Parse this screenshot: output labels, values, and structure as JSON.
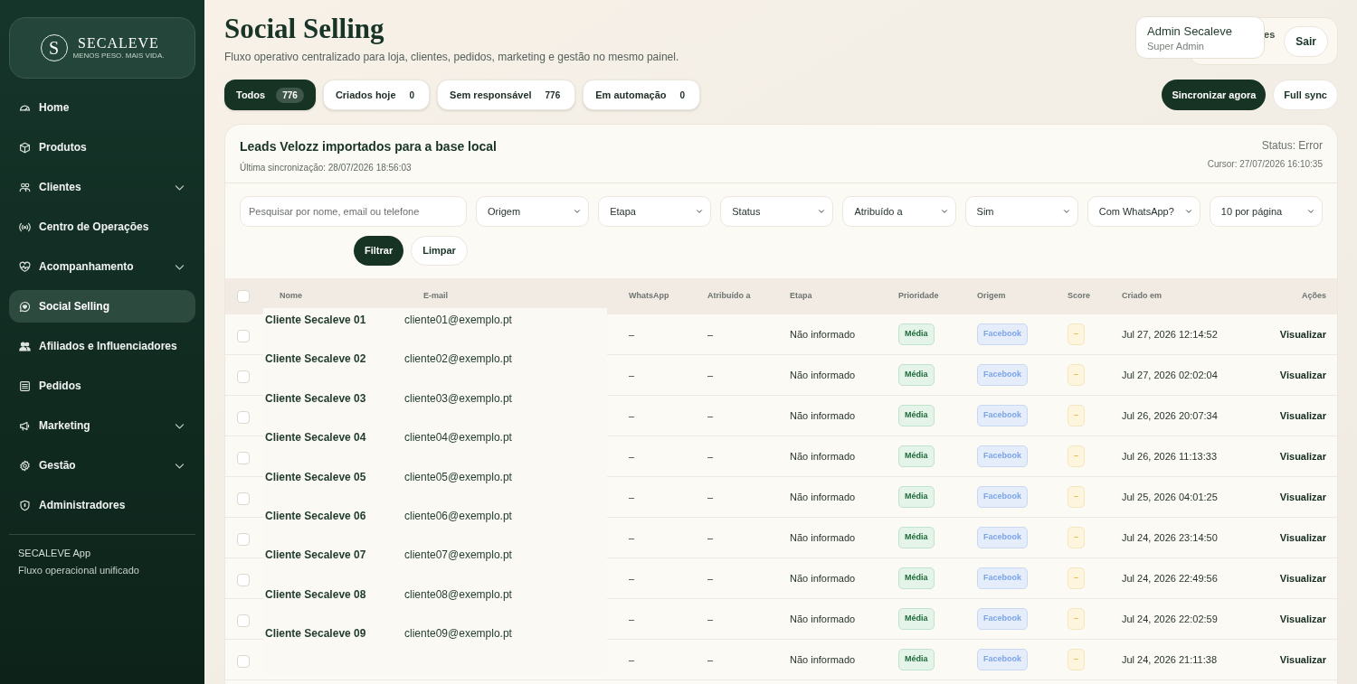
{
  "sidebar": {
    "logo": {
      "mark": "S",
      "name": "SECALEVE",
      "tagline": "MENOS PESO. MAIS VIDA."
    },
    "items": [
      {
        "label": "Home",
        "has_submenu": false,
        "selected": false
      },
      {
        "label": "Produtos",
        "has_submenu": false,
        "selected": false
      },
      {
        "label": "Clientes",
        "has_submenu": true,
        "selected": false
      },
      {
        "label": "Centro de Operações",
        "has_submenu": false,
        "selected": false
      },
      {
        "label": "Acompanhamento",
        "has_submenu": true,
        "selected": false
      },
      {
        "label": "Social Selling",
        "has_submenu": false,
        "selected": true
      },
      {
        "label": "Afiliados e Influenciadores",
        "has_submenu": false,
        "selected": false
      },
      {
        "label": "Pedidos",
        "has_submenu": false,
        "selected": false
      },
      {
        "label": "Marketing",
        "has_submenu": true,
        "selected": false
      },
      {
        "label": "Gestão",
        "has_submenu": true,
        "selected": false
      },
      {
        "label": "Administradores",
        "has_submenu": false,
        "selected": false
      }
    ],
    "footer": {
      "title": "SECALEVE App",
      "subtitle": "Fluxo operacional unificado"
    }
  },
  "header": {
    "title": "Social Selling",
    "subtitle": "Fluxo operativo centralizado para loja, clientes, pedidos, marketing e gestão no mesmo painel.",
    "user": {
      "name": "Admin Secaleve",
      "role": "Super Admin",
      "hidden_label": "es",
      "logout": "Sair"
    }
  },
  "tabs": [
    {
      "label": "Todos",
      "count": "776",
      "selected": true
    },
    {
      "label": "Criados hoje",
      "count": "0",
      "selected": false
    },
    {
      "label": "Sem responsável",
      "count": "776",
      "selected": false
    },
    {
      "label": "Em automação",
      "count": "0",
      "selected": false
    }
  ],
  "actions": [
    {
      "label": "Sincronizar agora",
      "kind": "primary"
    },
    {
      "label": "Full sync",
      "kind": "secondary"
    }
  ],
  "panel": {
    "title": "Leads Velozz importados para a base local",
    "last_sync": "Última sincronização: 28/07/2026 18:56:03",
    "status": "Status: Error",
    "cursor": "Cursor: 27/07/2026 16:10:35",
    "search": {
      "placeholder": "Pesquisar por nome, email ou telefone"
    },
    "filters": [
      "Origem",
      "Etapa",
      "Status",
      "Atribuído a",
      "Sim",
      "Com WhatsApp?",
      "10 por página"
    ],
    "buttons": [
      {
        "label": "Filtrar",
        "kind": "primary"
      },
      {
        "label": "Limpar",
        "kind": "secondary"
      }
    ]
  },
  "table": {
    "select_all": {
      "checked": false
    },
    "columns": [
      "Nome",
      "E-mail",
      "WhatsApp",
      "Atribuído a",
      "Etapa",
      "Prioridade",
      "Origem",
      "Score",
      "Criado em",
      "Ações"
    ],
    "rows": [
      {
        "checked": false,
        "name": "Cliente Secaleve 01",
        "email": "cliente01@exemplo.pt",
        "whatsapp": "–",
        "assigned": "–",
        "stage": "Não informado",
        "priority": "Média",
        "origin": "Facebook",
        "score": "–",
        "created": "Jul 27, 2026 12:14:52",
        "action": "Visualizar"
      },
      {
        "checked": false,
        "name": "Cliente Secaleve 02",
        "email": "cliente02@exemplo.pt",
        "whatsapp": "–",
        "assigned": "–",
        "stage": "Não informado",
        "priority": "Média",
        "origin": "Facebook",
        "score": "–",
        "created": "Jul 27, 2026 02:02:04",
        "action": "Visualizar"
      },
      {
        "checked": false,
        "name": "Cliente Secaleve 03",
        "email": "cliente03@exemplo.pt",
        "whatsapp": "–",
        "assigned": "–",
        "stage": "Não informado",
        "priority": "Média",
        "origin": "Facebook",
        "score": "–",
        "created": "Jul 26, 2026 20:07:34",
        "action": "Visualizar"
      },
      {
        "checked": false,
        "name": "Cliente Secaleve 04",
        "email": "cliente04@exemplo.pt",
        "whatsapp": "–",
        "assigned": "–",
        "stage": "Não informado",
        "priority": "Média",
        "origin": "Facebook",
        "score": "–",
        "created": "Jul 26, 2026 11:13:33",
        "action": "Visualizar"
      },
      {
        "checked": false,
        "name": "Cliente Secaleve 05",
        "email": "cliente05@exemplo.pt",
        "whatsapp": "–",
        "assigned": "–",
        "stage": "Não informado",
        "priority": "Média",
        "origin": "Facebook",
        "score": "–",
        "created": "Jul 25, 2026 04:01:25",
        "action": "Visualizar"
      },
      {
        "checked": false,
        "name": "Cliente Secaleve 06",
        "email": "cliente06@exemplo.pt",
        "whatsapp": "–",
        "assigned": "–",
        "stage": "Não informado",
        "priority": "Média",
        "origin": "Facebook",
        "score": "–",
        "created": "Jul 24, 2026 23:14:50",
        "action": "Visualizar"
      },
      {
        "checked": false,
        "name": "Cliente Secaleve 07",
        "email": "cliente07@exemplo.pt",
        "whatsapp": "–",
        "assigned": "–",
        "stage": "Não informado",
        "priority": "Média",
        "origin": "Facebook",
        "score": "–",
        "created": "Jul 24, 2026 22:49:56",
        "action": "Visualizar"
      },
      {
        "checked": false,
        "name": "Cliente Secaleve 08",
        "email": "cliente08@exemplo.pt",
        "whatsapp": "–",
        "assigned": "–",
        "stage": "Não informado",
        "priority": "Média",
        "origin": "Facebook",
        "score": "–",
        "created": "Jul 24, 2026 22:02:59",
        "action": "Visualizar"
      },
      {
        "checked": false,
        "name": "Cliente Secaleve 09",
        "email": "cliente09@exemplo.pt",
        "whatsapp": "–",
        "assigned": "–",
        "stage": "Não informado",
        "priority": "Média",
        "origin": "Facebook",
        "score": "–",
        "created": "Jul 24, 2026 21:11:38",
        "action": "Visualizar"
      }
    ]
  }
}
